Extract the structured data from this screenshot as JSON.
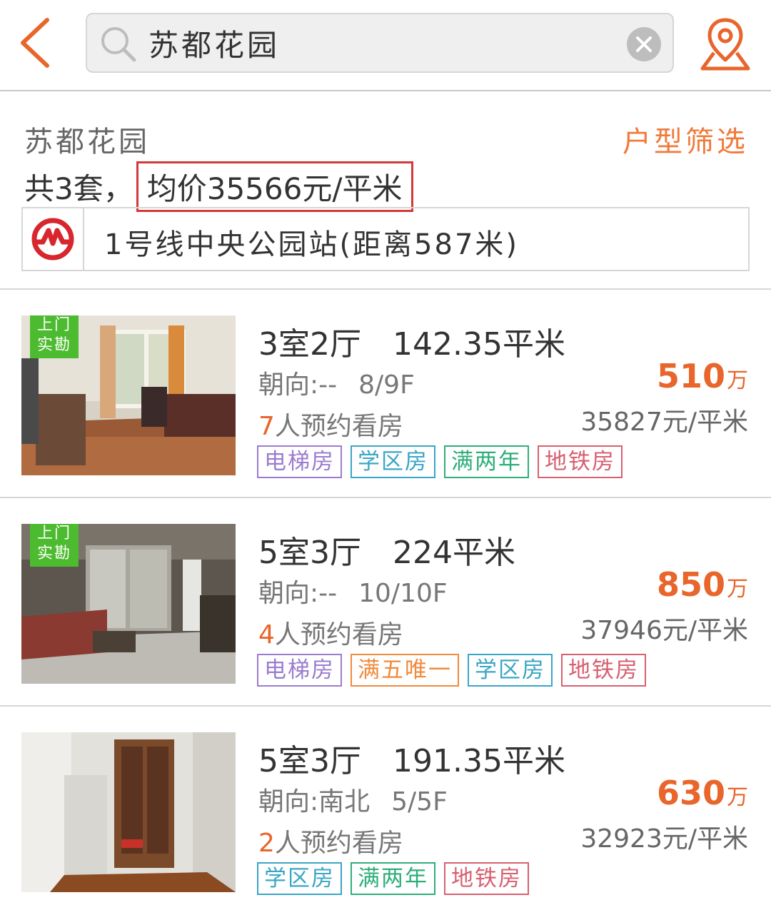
{
  "header": {
    "search_value": "苏都花园",
    "icons": {
      "back": "chevron-left-icon",
      "search": "search-icon",
      "clear": "close-icon",
      "map": "location-pin-icon"
    }
  },
  "summary": {
    "community_name": "苏都花园",
    "filter_label": "户型筛选",
    "count_text": "共3套，",
    "avg_price_text": "均价35566元/平米",
    "metro_text": "1号线中央公园站(距离587米)"
  },
  "listings": [
    {
      "badge": [
        "上门",
        "实勘"
      ],
      "layout": "3室2厅",
      "area": "142.35平米",
      "orientation": "朝向:--",
      "floor": "8/9F",
      "price_num": "510",
      "price_unit": "万",
      "viewers_num": "7",
      "viewers_text": "人预约看房",
      "unit_price": "35827元/平米",
      "tags": [
        "电梯房",
        "学区房",
        "满两年",
        "地铁房"
      ]
    },
    {
      "badge": [
        "上门",
        "实勘"
      ],
      "layout": "5室3厅",
      "area": "224平米",
      "orientation": "朝向:--",
      "floor": "10/10F",
      "price_num": "850",
      "price_unit": "万",
      "viewers_num": "4",
      "viewers_text": "人预约看房",
      "unit_price": "37946元/平米",
      "tags": [
        "电梯房",
        "满五唯一",
        "学区房",
        "地铁房"
      ]
    },
    {
      "layout": "5室3厅",
      "area": "191.35平米",
      "orientation": "朝向:南北",
      "floor": "5/5F",
      "price_num": "630",
      "price_unit": "万",
      "viewers_num": "2",
      "viewers_text": "人预约看房",
      "unit_price": "32923元/平米",
      "tags": [
        "学区房",
        "满两年",
        "地铁房"
      ]
    }
  ],
  "colors": {
    "accent": "#f07a3a",
    "price": "#e8652c",
    "badge": "#4dbb2f",
    "highlight_border": "#d23a3a",
    "tag_purple": "#9b7cd0",
    "tag_blue": "#3aa6c6",
    "tag_green": "#2eae7a",
    "tag_red": "#d86070",
    "tag_orange": "#f08a3c"
  }
}
